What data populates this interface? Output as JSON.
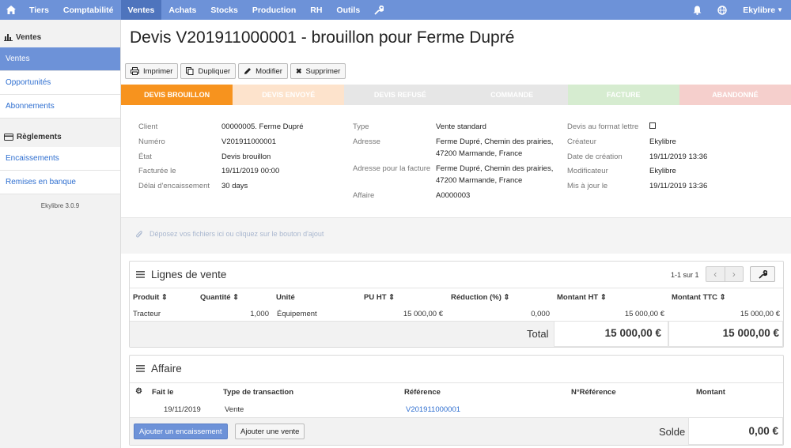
{
  "nav": {
    "items": [
      "Tiers",
      "Comptabilité",
      "Ventes",
      "Achats",
      "Stocks",
      "Production",
      "RH",
      "Outils"
    ],
    "active": "Ventes",
    "user": "Ekylibre"
  },
  "sidebar": {
    "section1": "Ventes",
    "items1": [
      "Ventes",
      "Opportunités",
      "Abonnements"
    ],
    "section2": "Règlements",
    "items2": [
      "Encaissements",
      "Remises en banque"
    ],
    "version": "Ekylibre 3.0.9"
  },
  "page": {
    "title": "Devis V201911000001 - brouillon pour Ferme Dupré"
  },
  "toolbar": {
    "print": "Imprimer",
    "duplicate": "Dupliquer",
    "edit": "Modifier",
    "delete": "Supprimer"
  },
  "status": [
    {
      "label": "DEVIS BROUILLON",
      "bg": "#f7931e",
      "color": "#ffffff"
    },
    {
      "label": "DEVIS ENVOYÉ",
      "bg": "#fde3cc",
      "color": "#ffffff"
    },
    {
      "label": "DEVIS REFUSÉ",
      "bg": "#e6e6e6",
      "color": "#ffffff"
    },
    {
      "label": "COMMANDE",
      "bg": "#e6e6e6",
      "color": "#ffffff"
    },
    {
      "label": "FACTURE",
      "bg": "#d6ecd0",
      "color": "#ffffff"
    },
    {
      "label": "ABANDONNÉ",
      "bg": "#f5cfcc",
      "color": "#ffffff"
    }
  ],
  "info": {
    "client_label": "Client",
    "client": "00000005. Ferme Dupré",
    "number_label": "Numéro",
    "number": "V201911000001",
    "state_label": "État",
    "state": "Devis brouillon",
    "invoiced_label": "Facturée le",
    "invoiced": "19/11/2019 00:00",
    "delay_label": "Délai d'encaissement",
    "delay": "30 days",
    "type_label": "Type",
    "type": "Vente standard",
    "address_label": "Adresse",
    "address1": "Ferme Dupré, Chemin des prairies,",
    "address2": "47200 Marmande, France",
    "billing_label": "Adresse pour la facture",
    "billing1": "Ferme Dupré, Chemin des prairies,",
    "billing2": "47200 Marmande, France",
    "affair_label": "Affaire",
    "affair": "A0000003",
    "letter_label": "Devis au format lettre",
    "creator_label": "Créateur",
    "creator": "Ekylibre",
    "created_label": "Date de création",
    "created": "19/11/2019 13:36",
    "modifier_label": "Modificateur",
    "modifier": "Ekylibre",
    "updated_label": "Mis à jour le",
    "updated": "19/11/2019 13:36"
  },
  "dropzone": "Déposez vos fichiers ici ou cliquez sur le bouton d'ajout",
  "lines": {
    "title": "Lignes de vente",
    "pagination": "1-1 sur 1",
    "headers": [
      "Produit",
      "Quantité",
      "Unité",
      "PU HT",
      "Réduction (%)",
      "Montant HT",
      "Montant TTC"
    ],
    "row": [
      "Tracteur",
      "1,000",
      "Équipement",
      "15 000,00 €",
      "0,000",
      "15 000,00 €",
      "15 000,00 €"
    ],
    "total_label": "Total",
    "total_ht": "15 000,00 €",
    "total_ttc": "15 000,00 €"
  },
  "affair": {
    "title": "Affaire",
    "headers": [
      "Fait le",
      "Type de transaction",
      "Référence",
      "N°Référence",
      "Montant"
    ],
    "row": [
      "19/11/2019",
      "Vente",
      "V201911000001"
    ],
    "add_payment": "Ajouter un encaissement",
    "add_sale": "Ajouter une vente",
    "balance_label": "Solde",
    "balance": "0,00 €"
  }
}
